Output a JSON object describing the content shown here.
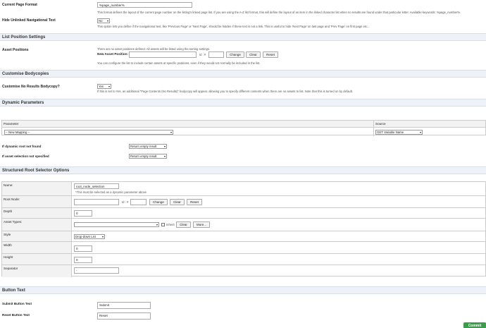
{
  "current_page_format": {
    "label": "Current Page Format",
    "value": "%page_number%",
    "note": "This format defines the layout of the current page number on the listing's linked page list. If you are using the A-Z list format, this will define the layout of an item in the linked character list when no results are found under that particular letter. Available keywords: %page_number%."
  },
  "hide_unlinked": {
    "label": "Hide Unlinked Navigational Text",
    "value": "No",
    "note": "This option lets you define if the navigational text, like 'Previous Page' or 'Next Page', should be hidden if these text is not a link. This is useful to hide 'Next Page' on last page and 'Prev Page' on first page etc..."
  },
  "list_position": {
    "heading": "List Position Settings",
    "label": "Asset Positions",
    "info": "There are no asset positions defined. All assets will be listed using the sorting settings.",
    "new_label": "New Asset Position:",
    "id_label": "Id : #",
    "change": "Change",
    "clear": "Clear",
    "reset": "Reset",
    "note": "You can configure the list to include certain assets at specific positions, even if they would not normally be included in the list."
  },
  "bodycopies": {
    "heading": "Customise Bodycopies",
    "label": "Customise No Results Bodycopy?",
    "value": "Yes",
    "note": "If this is set to Yes, an additional \"Page Contents (No Results)\" bodycopy will appear, allowing you to specify different contents when there are no assets to list. Note that this is turned on by default."
  },
  "dynamic": {
    "heading": "Dynamic Parameters",
    "col_parameter": "Parameter",
    "col_source": "Source",
    "mapping_value": "-- New Mapping --",
    "source_value": "GET Variable Name",
    "root_not_found_label": "If dynamic root not found",
    "root_not_found_value": "Return empty result",
    "not_specified_label": "If asset selection not specified",
    "not_specified_value": "Return empty result"
  },
  "structured": {
    "heading": "Structured Root Selector Options",
    "name_label": "Name:",
    "name_value": "root_node_selection",
    "name_note": "*This must be selected as a dynamic parameter above",
    "root_label": "Root Node:",
    "id_label": "Id : #",
    "change": "Change",
    "clear": "Clear",
    "reset": "Reset",
    "depth_label": "Depth",
    "depth_value": "0",
    "types_label": "Asset Types:",
    "inherit": "Inherit",
    "types_clear": "Clear",
    "types_more": "More...",
    "style_label": "Style",
    "style_value": "Drop-down List",
    "width_label": "Width",
    "width_value": "0",
    "height_label": "Height",
    "height_value": "0",
    "separator_label": "Separator",
    "separator_value": "-"
  },
  "button_text": {
    "heading": "Button Text",
    "submit_label": "Submit Button Text",
    "submit_value": "Submit",
    "reset_label": "Reset Button Text",
    "reset_value": "Reset"
  },
  "commit": "Commit"
}
